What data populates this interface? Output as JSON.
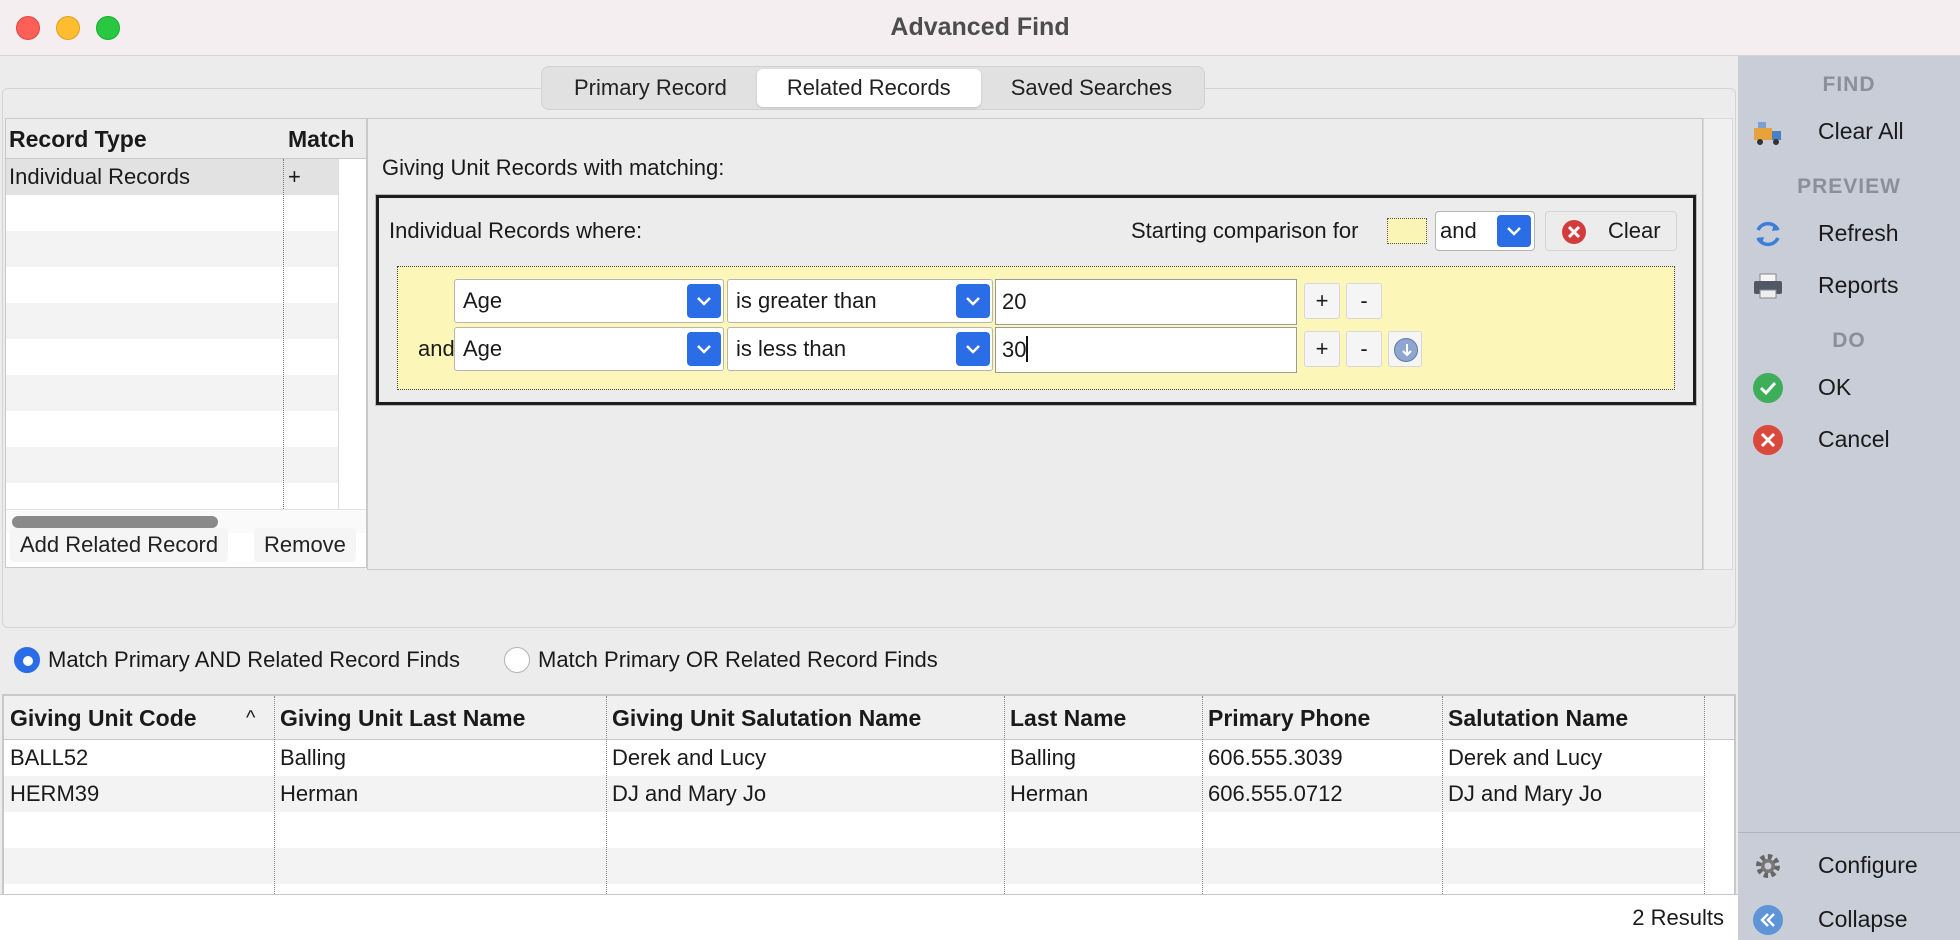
{
  "window": {
    "title": "Advanced Find"
  },
  "tabs": [
    {
      "label": "Primary Record",
      "selected": false
    },
    {
      "label": "Related Records",
      "selected": true
    },
    {
      "label": "Saved Searches",
      "selected": false
    }
  ],
  "record_types": {
    "headers": {
      "type": "Record Type",
      "match": "Match"
    },
    "rows": [
      {
        "type": "Individual Records",
        "match": "+"
      }
    ],
    "add_label": "Add Related Record",
    "remove_label": "Remove"
  },
  "criteria": {
    "heading": "Giving Unit Records with matching:",
    "group_label": "Individual Records where:",
    "starting_comparison_label": "Starting comparison for",
    "conjunction": "and",
    "clear_label": "Clear",
    "rows": [
      {
        "conjunction": "",
        "field": "Age",
        "operator": "is greater than",
        "value": "20"
      },
      {
        "conjunction": "and",
        "field": "Age",
        "operator": "is less than",
        "value": "30"
      }
    ],
    "plus": "+",
    "minus": "-"
  },
  "match_options": {
    "and_label": "Match Primary AND Related Record Finds",
    "or_label": "Match Primary OR Related Record Finds",
    "selected": "and"
  },
  "results": {
    "headers": [
      "Giving Unit Code",
      "Giving Unit Last Name",
      "Giving Unit Salutation Name",
      "Last Name",
      "Primary Phone",
      "Salutation Name"
    ],
    "sort_indicator": "^",
    "rows": [
      [
        "BALL52",
        "Balling",
        "Derek and Lucy",
        "Balling",
        "606.555.3039",
        "Derek and Lucy"
      ],
      [
        "HERM39",
        "Herman",
        "DJ and Mary Jo",
        "Herman",
        "606.555.0712",
        "DJ and Mary Jo"
      ]
    ],
    "count_label": "2 Results"
  },
  "sidebar": {
    "find_heading": "FIND",
    "clear_all": "Clear All",
    "preview_heading": "PREVIEW",
    "refresh": "Refresh",
    "reports": "Reports",
    "do_heading": "DO",
    "ok": "OK",
    "cancel": "Cancel",
    "configure": "Configure",
    "collapse": "Collapse"
  },
  "colors": {
    "accent": "#2b6de7",
    "highlight": "#fcf7b8",
    "sidebar": "#c9cdd8"
  }
}
